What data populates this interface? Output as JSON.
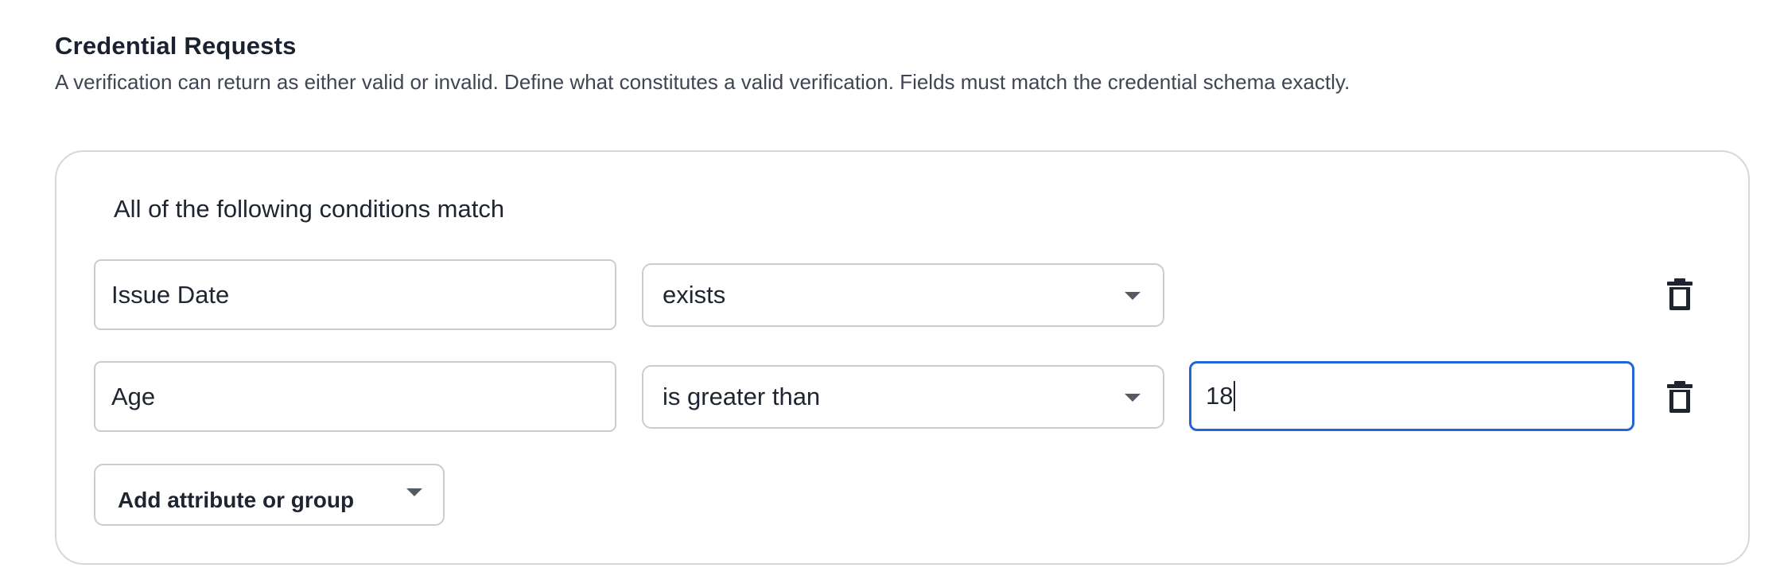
{
  "section": {
    "title": "Credential Requests",
    "description": "A verification can return as either valid or invalid. Define what constitutes a valid verification. Fields must match the credential schema exactly."
  },
  "group": {
    "label": "All of the following conditions match",
    "conditions": [
      {
        "attribute": "Issue Date",
        "operator": "exists",
        "value": null,
        "delete_icon": "trash-icon"
      },
      {
        "attribute": "Age",
        "operator": "is greater than",
        "value": "18",
        "delete_icon": "trash-icon"
      }
    ],
    "add_select_label": "Add attribute or group"
  },
  "colors": {
    "focus_border": "#2563d9",
    "border": "#c9ccd1",
    "text": "#1f2530"
  }
}
